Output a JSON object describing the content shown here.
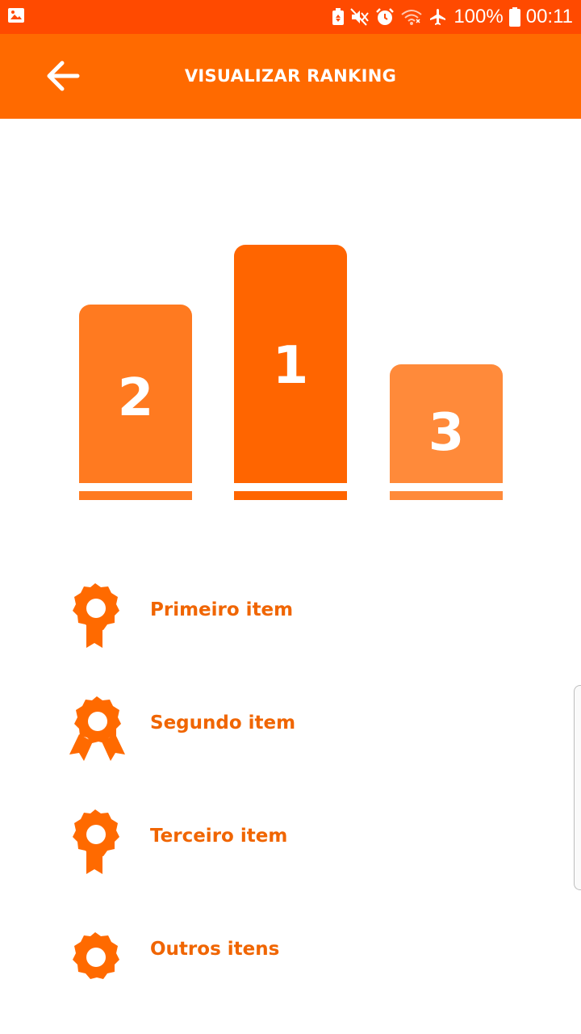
{
  "status_bar": {
    "battery_percent": "100%",
    "time": "00:11",
    "icons": [
      "image-icon",
      "battery-saver-icon",
      "mute-icon",
      "alarm-icon",
      "wifi-icon",
      "airplane-icon",
      "battery-icon"
    ]
  },
  "app_bar": {
    "title": "VISUALIZAR RANKING",
    "back_icon": "arrow-back-icon"
  },
  "podium": {
    "places": [
      {
        "label": "2",
        "color": "#ff7a20"
      },
      {
        "label": "1",
        "color": "#ff6500"
      },
      {
        "label": "3",
        "color": "#ff8a3a"
      }
    ]
  },
  "ranking_list": {
    "items": [
      {
        "label": "Primeiro item",
        "icon": "medal-ribbon-icon"
      },
      {
        "label": "Segundo item",
        "icon": "medal-wide-ribbon-icon"
      },
      {
        "label": "Terceiro item",
        "icon": "medal-ribbon-icon"
      },
      {
        "label": "Outros itens",
        "icon": "medal-icon"
      }
    ]
  },
  "colors": {
    "status_bar": "#ff4a00",
    "app_bar": "#ff6a00",
    "accent": "#f06500"
  }
}
